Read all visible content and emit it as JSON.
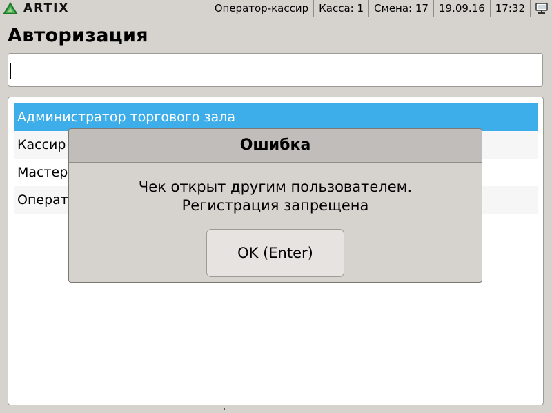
{
  "app": {
    "logo_text": "ARTIX"
  },
  "status_bar": {
    "role": "Оператор-кассир",
    "register": "Касса: 1",
    "shift": "Смена: 17",
    "date": "19.09.16",
    "time": "17:32",
    "network_icon": "network-icon"
  },
  "page": {
    "title": "Авторизация"
  },
  "password_field": {
    "value": ""
  },
  "user_list": {
    "items": [
      {
        "label": "Администратор торгового зала",
        "selected": true
      },
      {
        "label": "Кассир",
        "selected": false
      },
      {
        "label": "Мастер",
        "selected": false
      },
      {
        "label": "Операт",
        "selected": false
      }
    ]
  },
  "dialog": {
    "title": "Ошибка",
    "message_line1": "Чек открыт другим пользователем.",
    "message_line2": "Регистрация запрещена",
    "ok_label": "OK (Enter)"
  },
  "colors": {
    "background": "#d6d2ce",
    "selection": "#3daee9",
    "logo_green": "#2e8b3a"
  }
}
